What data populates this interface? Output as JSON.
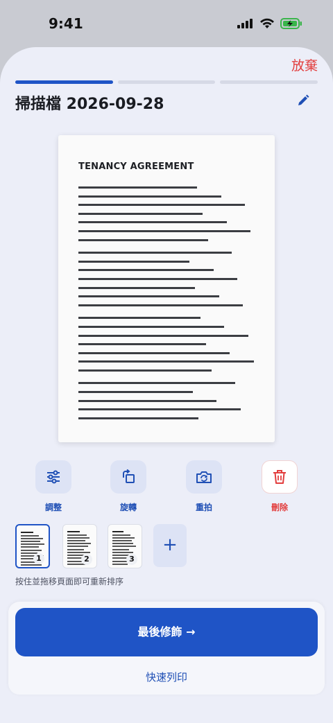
{
  "status_bar": {
    "time": "9:41"
  },
  "header": {
    "discard_label": "放棄",
    "title": "掃描檔 2026-09-28",
    "progress_step": 1,
    "progress_total": 3
  },
  "document": {
    "heading": "TENANCY AGREEMENT"
  },
  "tools": {
    "adjust": "調整",
    "rotate": "旋轉",
    "retake": "重拍",
    "delete": "刪除"
  },
  "pages": [
    {
      "number": "1",
      "selected": true
    },
    {
      "number": "2",
      "selected": false
    },
    {
      "number": "3",
      "selected": false
    }
  ],
  "add_page_label": "+",
  "reorder_hint": "按住並拖移頁面即可重新排序",
  "actions": {
    "primary": "最後修飾 →",
    "secondary": "快速列印"
  },
  "colors": {
    "accent": "#1f54c6",
    "danger": "#e23c3c",
    "background": "#eceef8"
  }
}
